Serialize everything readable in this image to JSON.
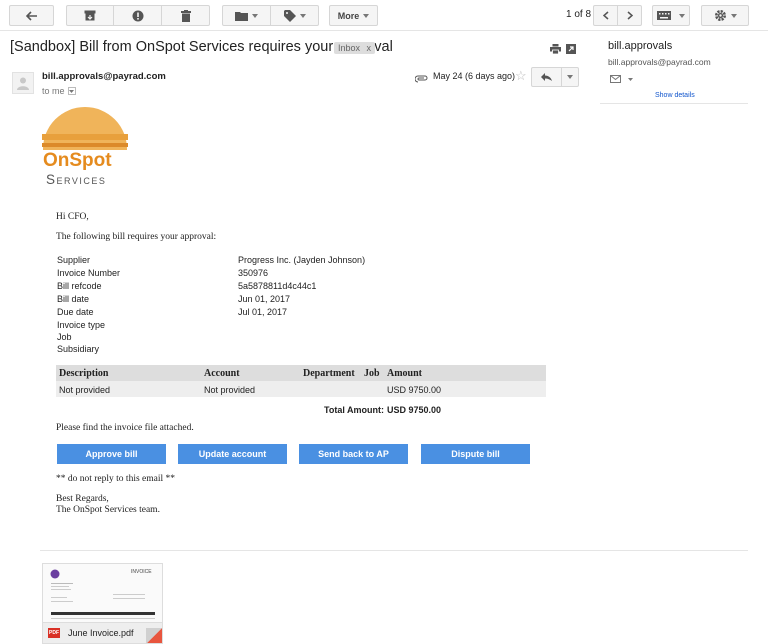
{
  "toolbar": {
    "more_label": "More",
    "page_count": "1 of 8"
  },
  "subject": "[Sandbox] Bill from OnSpot Services requires your approval",
  "inbox_badge": "Inbox",
  "inbox_badge_x": "x",
  "sender": {
    "email": "bill.approvals@payrad.com",
    "to": "to me",
    "date": "May 24 (6 days ago)"
  },
  "side": {
    "name": "bill.approvals",
    "email": "bill.approvals@payrad.com",
    "show_details": "Show details"
  },
  "logo": {
    "line1": "OnSpot",
    "line2": "Services"
  },
  "body": {
    "greeting": "Hi CFO,",
    "intro": "The following bill requires your approval:",
    "fields": [
      {
        "label": "Supplier",
        "value": "Progress Inc. (Jayden Johnson)"
      },
      {
        "label": "Invoice Number",
        "value": "350976"
      },
      {
        "label": "Bill refcode",
        "value": "5a5878811d4c44c1"
      },
      {
        "label": "Bill date",
        "value": "Jun 01, 2017"
      },
      {
        "label": "Due date",
        "value": "Jul 01, 2017"
      },
      {
        "label": "Invoice type",
        "value": ""
      },
      {
        "label": "Job",
        "value": ""
      },
      {
        "label": "Subsidiary",
        "value": ""
      }
    ],
    "table": {
      "headers": [
        "Description",
        "Account",
        "Department",
        "Job",
        "Amount"
      ],
      "row": [
        "Not provided",
        "Not provided",
        "",
        "",
        "USD 9750.00"
      ]
    },
    "total_label": "Total Amount:",
    "total_value": "USD 9750.00",
    "attached_note": "Please find the invoice file attached.",
    "buttons": [
      "Approve bill",
      "Update account",
      "Send back to AP",
      "Dispute bill"
    ],
    "noreply": "** do not reply to this email **",
    "regards": "Best Regards,",
    "team": "The OnSpot Services team."
  },
  "attachment": {
    "filename": "June Invoice.pdf",
    "pdf_label": "PDF",
    "thumb_title": "INVOICE"
  },
  "colors": {
    "button_blue": "#4a90e2",
    "logo_orange": "#e8a03c",
    "logo_text_orange": "#e58b1e",
    "logo_text_gray": "#555555"
  }
}
